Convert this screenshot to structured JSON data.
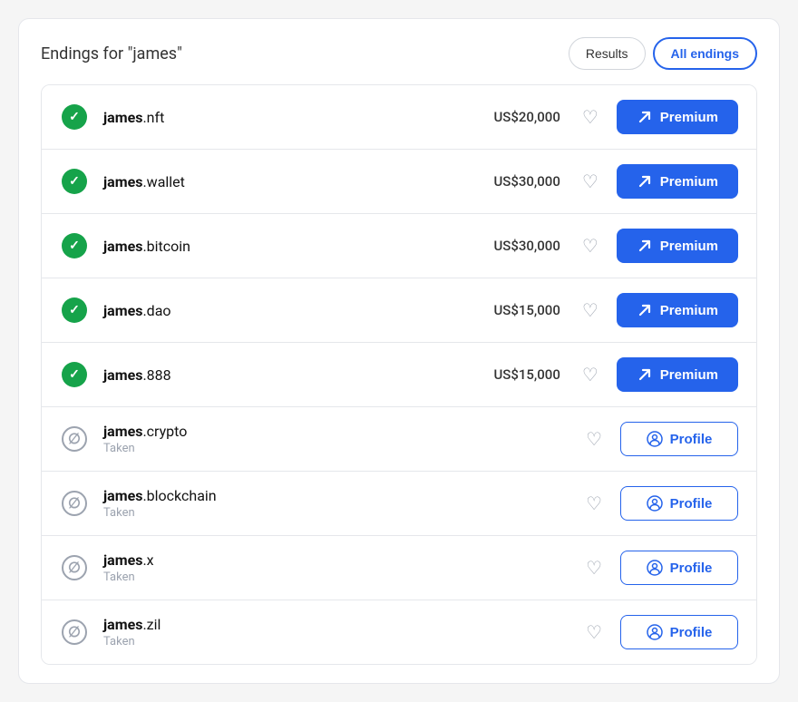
{
  "header": {
    "title_prefix": "Endings for ",
    "title_query": "\"james\"",
    "btn_results": "Results",
    "btn_all_endings": "All endings"
  },
  "domains": [
    {
      "id": "james-nft",
      "name_bold": "james",
      "name_ext": ".nft",
      "status": "available",
      "price": "US$20,000",
      "action": "premium"
    },
    {
      "id": "james-wallet",
      "name_bold": "james",
      "name_ext": ".wallet",
      "status": "available",
      "price": "US$30,000",
      "action": "premium"
    },
    {
      "id": "james-bitcoin",
      "name_bold": "james",
      "name_ext": ".bitcoin",
      "status": "available",
      "price": "US$30,000",
      "action": "premium"
    },
    {
      "id": "james-dao",
      "name_bold": "james",
      "name_ext": ".dao",
      "status": "available",
      "price": "US$15,000",
      "action": "premium"
    },
    {
      "id": "james-888",
      "name_bold": "james",
      "name_ext": ".888",
      "status": "available",
      "price": "US$15,000",
      "action": "premium"
    },
    {
      "id": "james-crypto",
      "name_bold": "james",
      "name_ext": ".crypto",
      "status": "taken",
      "status_label": "Taken",
      "price": "",
      "action": "profile"
    },
    {
      "id": "james-blockchain",
      "name_bold": "james",
      "name_ext": ".blockchain",
      "status": "taken",
      "status_label": "Taken",
      "price": "",
      "action": "profile"
    },
    {
      "id": "james-x",
      "name_bold": "james",
      "name_ext": ".x",
      "status": "taken",
      "status_label": "Taken",
      "price": "",
      "action": "profile"
    },
    {
      "id": "james-zil",
      "name_bold": "james",
      "name_ext": ".zil",
      "status": "taken",
      "status_label": "Taken",
      "price": "",
      "action": "profile"
    }
  ],
  "labels": {
    "premium": "Premium",
    "profile": "Profile",
    "taken": "Taken"
  }
}
